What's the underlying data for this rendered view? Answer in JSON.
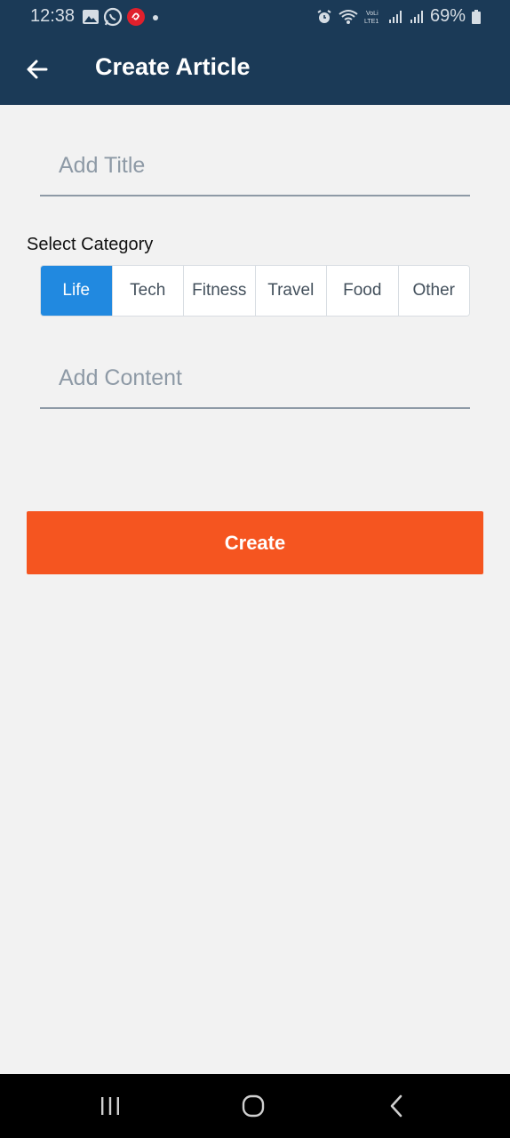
{
  "status_bar": {
    "time": "12:38",
    "left_icons": [
      "image-icon",
      "whatsapp-icon",
      "airtel-icon",
      "dot-icon"
    ],
    "battery_percent": "69%",
    "right_icons": [
      "alarm-icon",
      "wifi-calling-icon",
      "volte-icon",
      "signal-icon",
      "signal-icon",
      "battery-icon"
    ]
  },
  "header": {
    "title": "Create Article",
    "back_icon": "arrow-left-icon"
  },
  "form": {
    "title_placeholder": "Add Title",
    "title_value": "",
    "category_label": "Select Category",
    "categories": [
      {
        "label": "Life",
        "selected": true
      },
      {
        "label": "Tech",
        "selected": false
      },
      {
        "label": "Fitness",
        "selected": false
      },
      {
        "label": "Travel",
        "selected": false
      },
      {
        "label": "Food",
        "selected": false
      },
      {
        "label": "Other",
        "selected": false
      }
    ],
    "content_placeholder": "Add Content",
    "content_value": "",
    "submit_label": "Create"
  },
  "colors": {
    "header_bg": "#1b3a57",
    "selected_segment": "#2189e0",
    "create_button": "#f55520",
    "page_bg": "#f2f2f2"
  },
  "nav_bar": {
    "buttons": [
      "recents-icon",
      "home-icon",
      "back-icon"
    ]
  }
}
